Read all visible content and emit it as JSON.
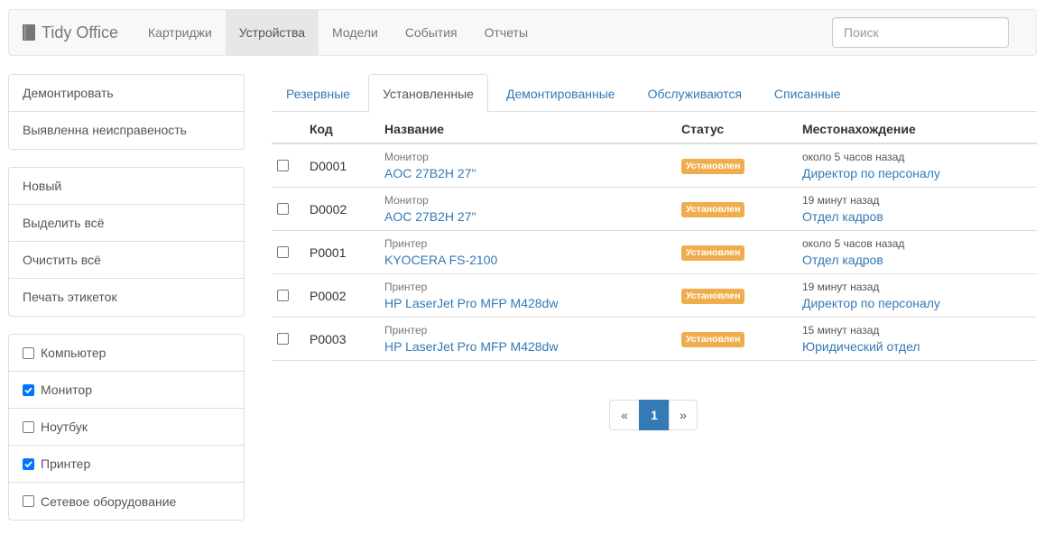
{
  "navbar": {
    "brand": "Tidy Office",
    "brand_icon": "book-icon",
    "items": [
      {
        "label": "Картриджи",
        "active": false
      },
      {
        "label": "Устройства",
        "active": true
      },
      {
        "label": "Модели",
        "active": false
      },
      {
        "label": "События",
        "active": false
      },
      {
        "label": "Отчеты",
        "active": false
      }
    ],
    "search_placeholder": "Поиск"
  },
  "sidebar": {
    "actions": [
      "Демонтировать",
      "Выявленна неисправеность"
    ],
    "commands": [
      "Новый",
      "Выделить всё",
      "Очистить всё",
      "Печать этикеток"
    ],
    "filters": [
      {
        "label": "Компьютер",
        "checked": false
      },
      {
        "label": "Монитор",
        "checked": true
      },
      {
        "label": "Ноутбук",
        "checked": false
      },
      {
        "label": "Принтер",
        "checked": true
      },
      {
        "label": "Сетевое оборудование",
        "checked": false
      }
    ]
  },
  "tabs": [
    {
      "label": "Резервные",
      "active": false
    },
    {
      "label": "Установленные",
      "active": true
    },
    {
      "label": "Демонтированные",
      "active": false
    },
    {
      "label": "Обслуживаются",
      "active": false
    },
    {
      "label": "Списанные",
      "active": false
    }
  ],
  "table": {
    "headers": {
      "code": "Код",
      "name": "Название",
      "status": "Статус",
      "location": "Местонахождение"
    },
    "rows": [
      {
        "code": "D0001",
        "type": "Монитор",
        "name": "AOC 27B2H 27\"",
        "status": "Установлен",
        "time": "около 5 часов назад",
        "location": "Директор по персоналу"
      },
      {
        "code": "D0002",
        "type": "Монитор",
        "name": "AOC 27B2H 27\"",
        "status": "Установлен",
        "time": "19 минут назад",
        "location": "Отдел кадров"
      },
      {
        "code": "P0001",
        "type": "Принтер",
        "name": "KYOCERA FS-2100",
        "status": "Установлен",
        "time": "около 5 часов назад",
        "location": "Отдел кадров"
      },
      {
        "code": "P0002",
        "type": "Принтер",
        "name": "HP LaserJet Pro MFP M428dw",
        "status": "Установлен",
        "time": "19 минут назад",
        "location": "Директор по персоналу"
      },
      {
        "code": "P0003",
        "type": "Принтер",
        "name": "HP LaserJet Pro MFP M428dw",
        "status": "Установлен",
        "time": "15 минут назад",
        "location": "Юридический отдел"
      }
    ]
  },
  "pagination": {
    "prev": "«",
    "current": "1",
    "next": "»"
  },
  "colors": {
    "link": "#337ab7",
    "badge": "#f0ad4e",
    "checkbox": "#0075ff"
  }
}
